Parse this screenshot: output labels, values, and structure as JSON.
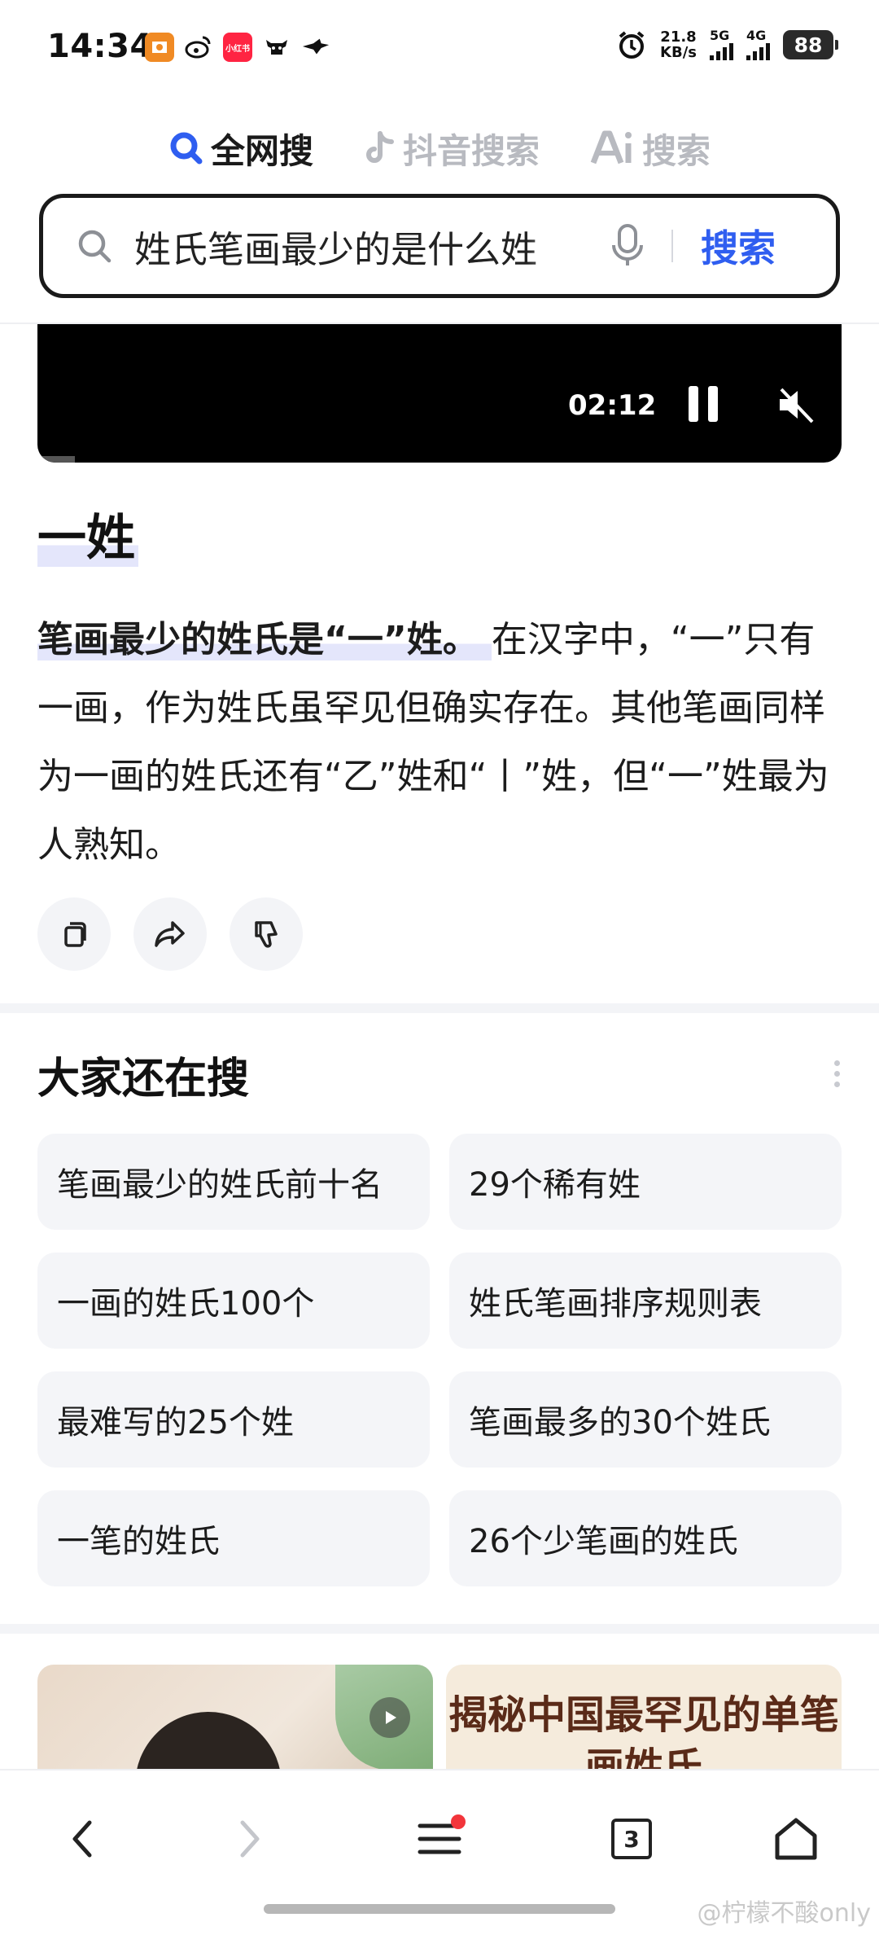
{
  "status_bar": {
    "time": "14:34",
    "net_speed_value": "21.8",
    "net_speed_unit": "KB/s",
    "sim1_label": "5G",
    "sim2_label": "4G",
    "battery": "88",
    "app_icons": [
      "pokebox-icon",
      "weibo-icon",
      "xiaohongshu-icon",
      "cow-icon",
      "bird-icon"
    ],
    "xhs_text": "小红书"
  },
  "tabs": [
    {
      "label": "全网搜",
      "active": true
    },
    {
      "label": "抖音搜索",
      "active": false
    },
    {
      "label": "搜索",
      "active": false
    }
  ],
  "search": {
    "query": "姓氏笔画最少的是什么姓",
    "button": "搜索"
  },
  "video": {
    "time": "02:12"
  },
  "answer": {
    "title": "一姓",
    "highlight": "笔画最少的姓氏是“一”姓。",
    "body": "在汉字中，“一”只有一画，作为姓氏虽罕见但确实存在。其他笔画同样为一画的姓氏还有“乙”姓和“丨”姓，但“一”姓最为人熟知。"
  },
  "related": {
    "title": "大家还在搜",
    "items": [
      "笔画最少的姓氏前十名",
      "29个稀有姓",
      "一画的姓氏100个",
      "姓氏笔画排序规则表",
      "最难写的25个姓",
      "笔画最多的30个姓氏",
      "一笔的姓氏",
      "26个少笔画的姓氏"
    ]
  },
  "cards": {
    "right_title": "揭秘中国最罕见的单笔画姓氏"
  },
  "bottom_nav": {
    "tab_count": "3"
  },
  "watermark": "@柠檬不酸only"
}
